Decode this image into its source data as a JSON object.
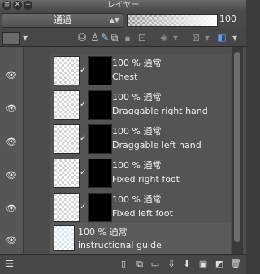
{
  "window": {
    "title": "レイヤー",
    "close_icon": "close-icon",
    "minimize_icon": "minimize-icon"
  },
  "toolbar": {
    "blend_mode": "通過",
    "opacity": "100"
  },
  "layers": [
    {
      "mode": "100 % 通常",
      "name": "Chest"
    },
    {
      "mode": "100 % 通常",
      "name": "Draggable right hand"
    },
    {
      "mode": "100 % 通常",
      "name": "Draggable left hand"
    },
    {
      "mode": "100 % 通常",
      "name": "Fixed right foot"
    },
    {
      "mode": "100 % 通常",
      "name": "Fixed left foot"
    }
  ],
  "guide_layer": {
    "mode": "100 % 通常",
    "name": "instructional guide"
  },
  "colors": {
    "panel_bg": "#3c3c3c",
    "row_bg": "#545454",
    "text": "#f0f0f0",
    "mask": "#000000"
  }
}
